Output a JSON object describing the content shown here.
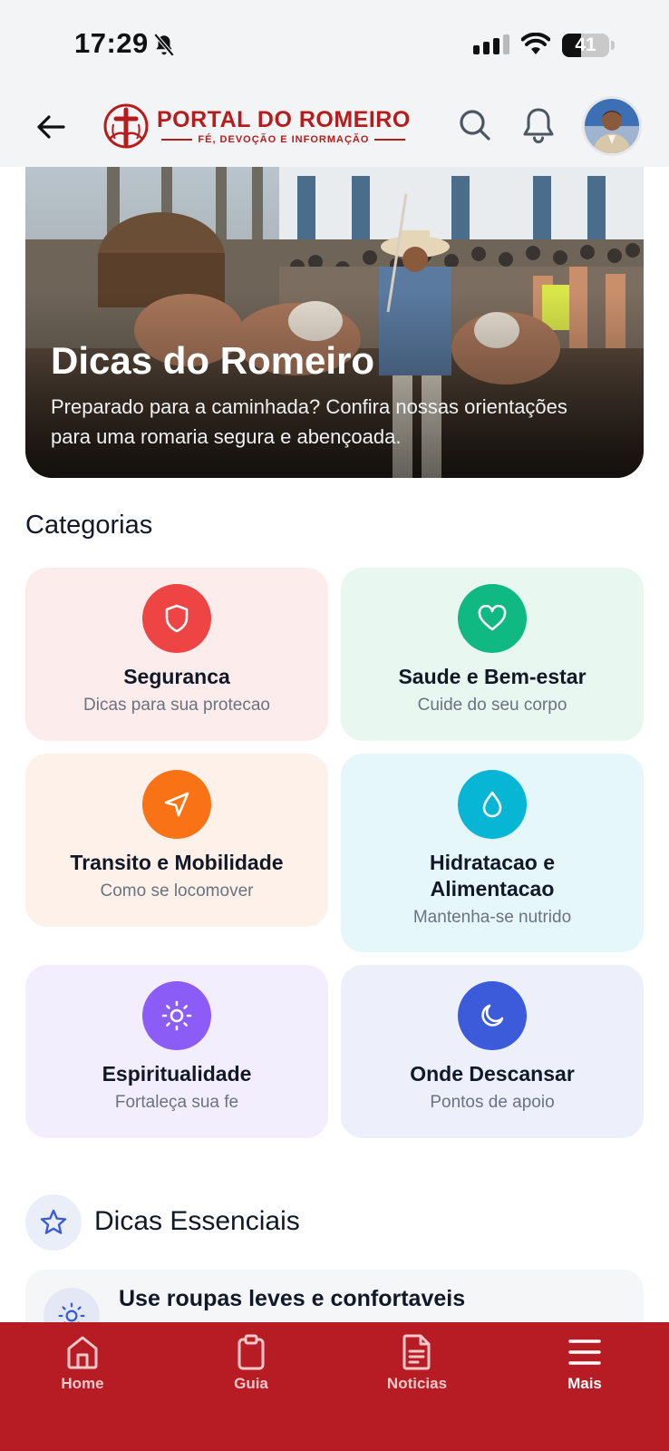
{
  "status_bar": {
    "time": "17:29",
    "battery": "41",
    "battery_level": 0.41
  },
  "header": {
    "logo_title": "PORTAL DO ROMEIRO",
    "logo_subtitle": "FÉ, DEVOÇÃO E INFORMAÇÃO",
    "icons": [
      "back-arrow-icon",
      "search-icon",
      "bell-icon",
      "avatar"
    ]
  },
  "hero": {
    "title": "Dicas do Romeiro",
    "description": "Preparado para a caminhada? Confira nossas orientações para uma romaria segura e abençoada."
  },
  "categories": {
    "title": "Categorias",
    "items": [
      {
        "title": "Seguranca",
        "subtitle": "Dicas para sua protecao",
        "icon": "shield-icon",
        "bg": "#fdecec",
        "color": "#ef4444"
      },
      {
        "title": "Saude e Bem-estar",
        "subtitle": "Cuide do seu corpo",
        "icon": "heart-icon",
        "bg": "#e8f7f0",
        "color": "#10b981"
      },
      {
        "title": "Transito e Mobilidade",
        "subtitle": "Como se locomover",
        "icon": "navigation-icon",
        "bg": "#fdf1ea",
        "color": "#f97316"
      },
      {
        "title": "Hidratacao e Alimentacao",
        "subtitle": "Mantenha-se nutrido",
        "icon": "droplet-icon",
        "bg": "#e6f7fb",
        "color": "#06b6d4"
      },
      {
        "title": "Espiritualidade",
        "subtitle": "Fortaleça sua fe",
        "icon": "sun-icon",
        "bg": "#f3eefd",
        "color": "#8b5cf6"
      },
      {
        "title": "Onde Descansar",
        "subtitle": "Pontos de apoio",
        "icon": "moon-icon",
        "bg": "#edf0fb",
        "color": "#3b5bdb"
      }
    ]
  },
  "dicas": {
    "title": "Dicas Essenciais",
    "icon": "star-icon",
    "first_tip": "Use roupas leves e confortaveis"
  },
  "bottom_nav": [
    {
      "label": "Home",
      "icon": "home-icon",
      "active": false
    },
    {
      "label": "Guia",
      "icon": "clipboard-icon",
      "active": false
    },
    {
      "label": "Noticias",
      "icon": "document-icon",
      "active": false
    },
    {
      "label": "Mais",
      "icon": "menu-icon",
      "active": true
    }
  ]
}
